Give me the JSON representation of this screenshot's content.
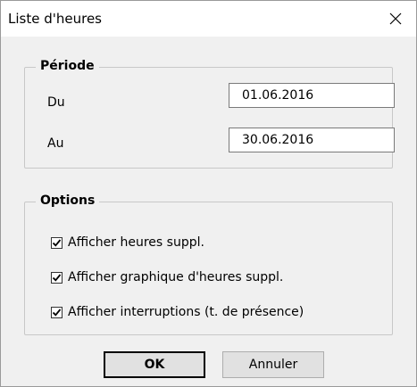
{
  "window": {
    "title": "Liste d'heures"
  },
  "periode": {
    "legend": "Période",
    "du_label": "Du",
    "du_value": "01.06.2016",
    "au_label": "Au",
    "au_value": "30.06.2016"
  },
  "options": {
    "legend": "Options",
    "items": [
      {
        "label": "Afficher heures suppl.",
        "checked": true
      },
      {
        "label": "Afficher graphique d'heures suppl.",
        "checked": true
      },
      {
        "label": "Afficher interruptions (t. de présence)",
        "checked": true
      }
    ]
  },
  "buttons": {
    "ok": "OK",
    "cancel": "Annuler"
  }
}
